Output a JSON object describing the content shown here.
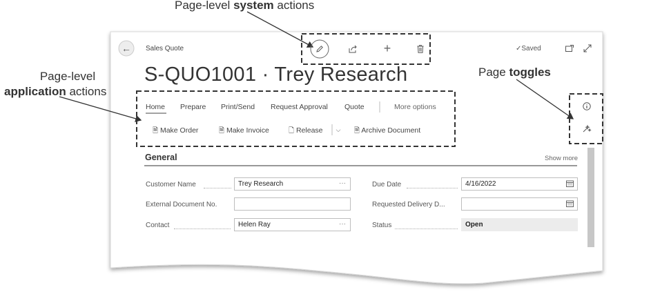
{
  "callouts": {
    "system_actions_pre": "Page-level ",
    "system_actions_bold": "system",
    "system_actions_post": " actions",
    "app_actions_line1": "Page-level",
    "app_actions_bold": "application",
    "app_actions_post": " actions",
    "toggles_pre": "Page ",
    "toggles_bold": "toggles"
  },
  "header": {
    "breadcrumb": "Sales Quote",
    "saved_label": "Saved",
    "title": "S-QUO1001 · Trey Research"
  },
  "menu_tabs": [
    "Home",
    "Prepare",
    "Print/Send",
    "Request Approval",
    "Quote",
    "More options"
  ],
  "actions": {
    "make_order": "Make Order",
    "make_invoice": "Make Invoice",
    "release": "Release",
    "archive_document": "Archive Document"
  },
  "section": {
    "title": "General",
    "show_more": "Show more"
  },
  "fields": {
    "customer_name_label": "Customer Name",
    "customer_name_value": "Trey Research",
    "external_doc_label": "External Document No.",
    "external_doc_value": "",
    "contact_label": "Contact",
    "contact_value": "Helen Ray",
    "due_date_label": "Due Date",
    "due_date_value": "4/16/2022",
    "requested_delivery_label": "Requested Delivery D...",
    "requested_delivery_value": "",
    "status_label": "Status",
    "status_value": "Open"
  },
  "icons": {
    "back": "arrow-left-icon",
    "edit": "pencil-icon",
    "share": "share-icon",
    "new": "plus-icon",
    "delete": "trash-icon",
    "open_new_window": "open-in-new-window-icon",
    "expand": "expand-icon",
    "info": "info-icon",
    "personalize": "personalize-icon"
  }
}
